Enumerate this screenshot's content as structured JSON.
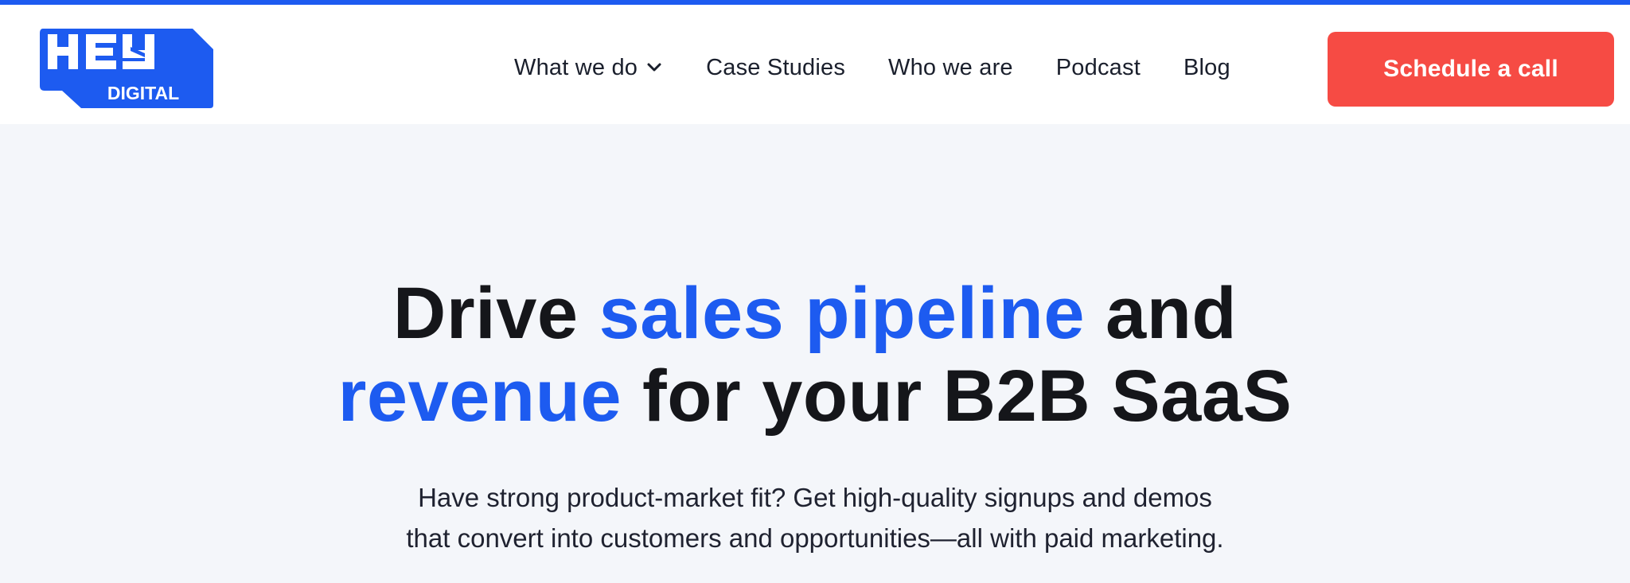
{
  "brand": {
    "logo_text_top": "HEY",
    "logo_text_bottom": "DIGITAL",
    "colors": {
      "primary": "#1d5bf0",
      "cta": "#f64b44",
      "hero_bg": "#f4f6fa",
      "text_dark": "#15161a"
    }
  },
  "nav": {
    "items": [
      {
        "label": "What we do",
        "has_dropdown": true,
        "icon": "chevron-down-icon"
      },
      {
        "label": "Case Studies"
      },
      {
        "label": "Who we are"
      },
      {
        "label": "Podcast"
      },
      {
        "label": "Blog"
      }
    ],
    "cta_label": "Schedule a call"
  },
  "hero": {
    "headline": {
      "part1": "Drive ",
      "highlight1": "sales pipeline",
      "part2": " and",
      "highlight2": "revenue",
      "part3": " for your B2B SaaS"
    },
    "subtext_line1": "Have strong product-market fit? Get high-quality signups and demos",
    "subtext_line2": "that convert into customers and opportunities—all with paid marketing."
  }
}
